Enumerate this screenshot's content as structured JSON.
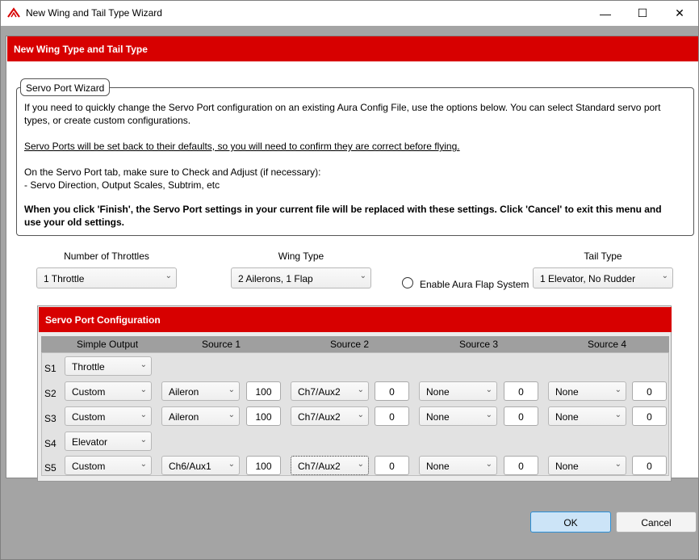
{
  "window": {
    "title": "New Wing and Tail Type Wizard",
    "min_glyph": "—",
    "max_glyph": "☐",
    "close_glyph": "✕"
  },
  "header": {
    "title": "New Wing Type and Tail Type"
  },
  "wizard": {
    "legend": "Servo Port Wizard",
    "line1": "If you need to quickly change the Servo Port configuration on an existing Aura Config File, use the options below. You can select Standard servo port types, or create custom configurations.",
    "warning": "Servo Ports will be set back to their defaults, so you will need to confirm they are correct before flying.",
    "check_title": "On the Servo Port tab, make sure to Check and Adjust (if necessary):",
    "check_items": "- Servo Direction, Output Scales, Subtrim, etc",
    "finish_note": "When you click 'Finish', the Servo Port settings in your current file will be replaced with these settings. Click 'Cancel' to exit this menu and use your old settings."
  },
  "options": {
    "throttles_label": "Number of Throttles",
    "throttles_value": "1 Throttle",
    "wing_label": "Wing Type",
    "wing_value": "2 Ailerons, 1 Flap",
    "flap_label": "Enable Aura Flap System",
    "flap_checked": false,
    "tail_label": "Tail Type",
    "tail_value": "1 Elevator, No Rudder"
  },
  "servo": {
    "title": "Servo Port Configuration",
    "columns": [
      "Simple Output",
      "Source 1",
      "Source 2",
      "Source 3",
      "Source 4"
    ],
    "rows": [
      {
        "label": "S1",
        "output": "Throttle"
      },
      {
        "label": "S2",
        "output": "Custom",
        "s1": "Aileron",
        "v1": "100",
        "s2": "Ch7/Aux2",
        "v2": "0",
        "s3": "None",
        "v3": "0",
        "s4": "None",
        "v4": "0"
      },
      {
        "label": "S3",
        "output": "Custom",
        "s1": "Aileron",
        "v1": "100",
        "s2": "Ch7/Aux2",
        "v2": "0",
        "s3": "None",
        "v3": "0",
        "s4": "None",
        "v4": "0"
      },
      {
        "label": "S4",
        "output": "Elevator"
      },
      {
        "label": "S5",
        "output": "Custom",
        "s1": "Ch6/Aux1",
        "v1": "100",
        "s2": "Ch7/Aux2",
        "v2": "0",
        "s3": "None",
        "v3": "0",
        "s4": "None",
        "v4": "0"
      }
    ]
  },
  "buttons": {
    "ok": "OK",
    "cancel": "Cancel"
  },
  "colors": {
    "accent_red": "#d70000",
    "ok_blue": "#cce4f7"
  }
}
